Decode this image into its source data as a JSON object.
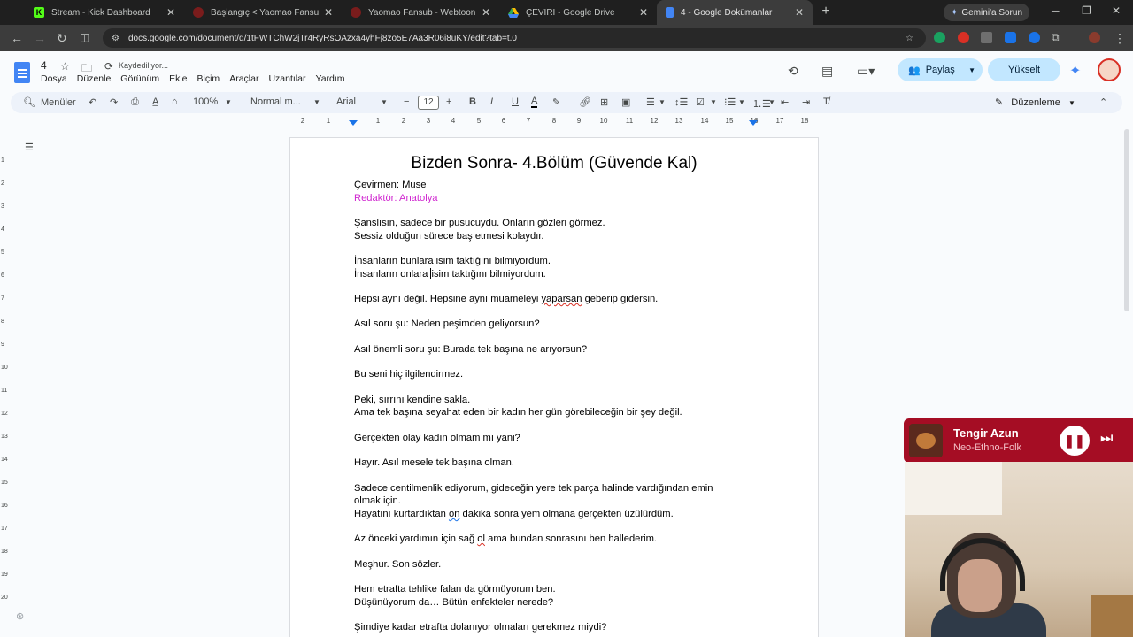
{
  "browser": {
    "tabs": [
      {
        "title": "Stream - Kick Dashboard",
        "icon": "kick-icon",
        "color": "#53fc18",
        "letter": "K"
      },
      {
        "title": "Başlangıç < Yaomao Fansub — W",
        "icon": "yaomao-icon",
        "color": "#7a1c1c",
        "letter": ""
      },
      {
        "title": "Yaomao Fansub - Webtoon Oku",
        "icon": "yaomao-icon",
        "color": "#7a1c1c",
        "letter": ""
      },
      {
        "title": "ÇEVİRİ - Google Drive",
        "icon": "drive-icon",
        "color": "#34a853",
        "letter": ""
      },
      {
        "title": "4 - Google Dokümanlar",
        "icon": "docs-icon",
        "color": "#4285f4",
        "letter": ""
      }
    ],
    "gemini_button": "Gemini'a Sorun",
    "url": "docs.google.com/document/d/1tFWTChW2jTr4RyRsOAzxa4yhFj8zo5E7Aa3R06i8uKY/edit?tab=t.0"
  },
  "docs": {
    "title": "4",
    "saving_status": "Kaydediliyor...",
    "menu": [
      "Dosya",
      "Düzenle",
      "Görünüm",
      "Ekle",
      "Biçim",
      "Araçlar",
      "Uzantılar",
      "Yardım"
    ],
    "share_label": "Paylaş",
    "upgrade_label": "Yükselt",
    "toolbar": {
      "menus_label": "Menüler",
      "zoom": "100%",
      "style": "Normal m...",
      "font": "Arial",
      "font_size": "12",
      "edit_mode": "Düzenleme"
    },
    "ruler_numbers": [
      "2",
      "1",
      "1",
      "2",
      "3",
      "4",
      "5",
      "6",
      "7",
      "8",
      "9",
      "10",
      "11",
      "12",
      "13",
      "14",
      "15",
      "16",
      "17",
      "18"
    ],
    "vruler_numbers": [
      "1",
      "2",
      "3",
      "4",
      "5",
      "6",
      "7",
      "8",
      "9",
      "10",
      "11",
      "12",
      "13",
      "14",
      "15",
      "16",
      "17",
      "18",
      "19",
      "20"
    ]
  },
  "document": {
    "heading": "Bizden Sonra- 4.Bölüm (Güvende Kal)",
    "translator": "Çevirmen: Muse",
    "editor": "Redaktör: Anatolya",
    "l1": "Şanslısın, sadece bir pusucuydu. Onların gözleri görmez.",
    "l2": "Sessiz olduğun sürece baş etmesi kolaydır.",
    "l3": "İnsanların bunlara isim taktığını bilmiyordum.",
    "l4a": "İnsanların onlara ",
    "l4b": "isim taktığını bilmiyordum.",
    "l5a": "Hepsi aynı değil. Hepsine aynı muameleyi ",
    "l5b": "yaparsan",
    "l5c": " geberip gidersin.",
    "l6": "Asıl soru şu: Neden peşimden geliyorsun?",
    "l7": "Asıl önemli soru şu: Burada tek başına ne arıyorsun?",
    "l8": "Bu seni hiç ilgilendirmez.",
    "l9": "Peki, sırrını kendine sakla.",
    "l10": "Ama tek başına seyahat eden bir kadın her gün görebileceğin bir şey değil.",
    "l11": "Gerçekten olay kadın olmam mı yani?",
    "l12": "Hayır. Asıl mesele tek başına olman.",
    "l13": "Sadece centilmenlik ediyorum, gideceğin yere tek parça halinde vardığından emin",
    "l14": "olmak için.",
    "l15a": "Hayatını kurtardıktan ",
    "l15b": "on",
    "l15c": " dakika sonra yem olmana gerçekten üzülürdüm.",
    "l16a": "Az önceki yardımın için sağ ",
    "l16b": "ol",
    "l16c": " ama bundan sonrasını ben hallederim.",
    "l17": "Meşhur. Son sözler.",
    "l18": "Hem etrafta tehlike falan da görmüyorum ben.",
    "l19": "Düşünüyorum da… Bütün enfekteler nerede?",
    "l20": "Şimdiye kadar etrafta dolanıyor olmaları gerekmez miydi?"
  },
  "music": {
    "artist": "Tengir Azun",
    "genre": "Neo-Ethno-Folk"
  }
}
